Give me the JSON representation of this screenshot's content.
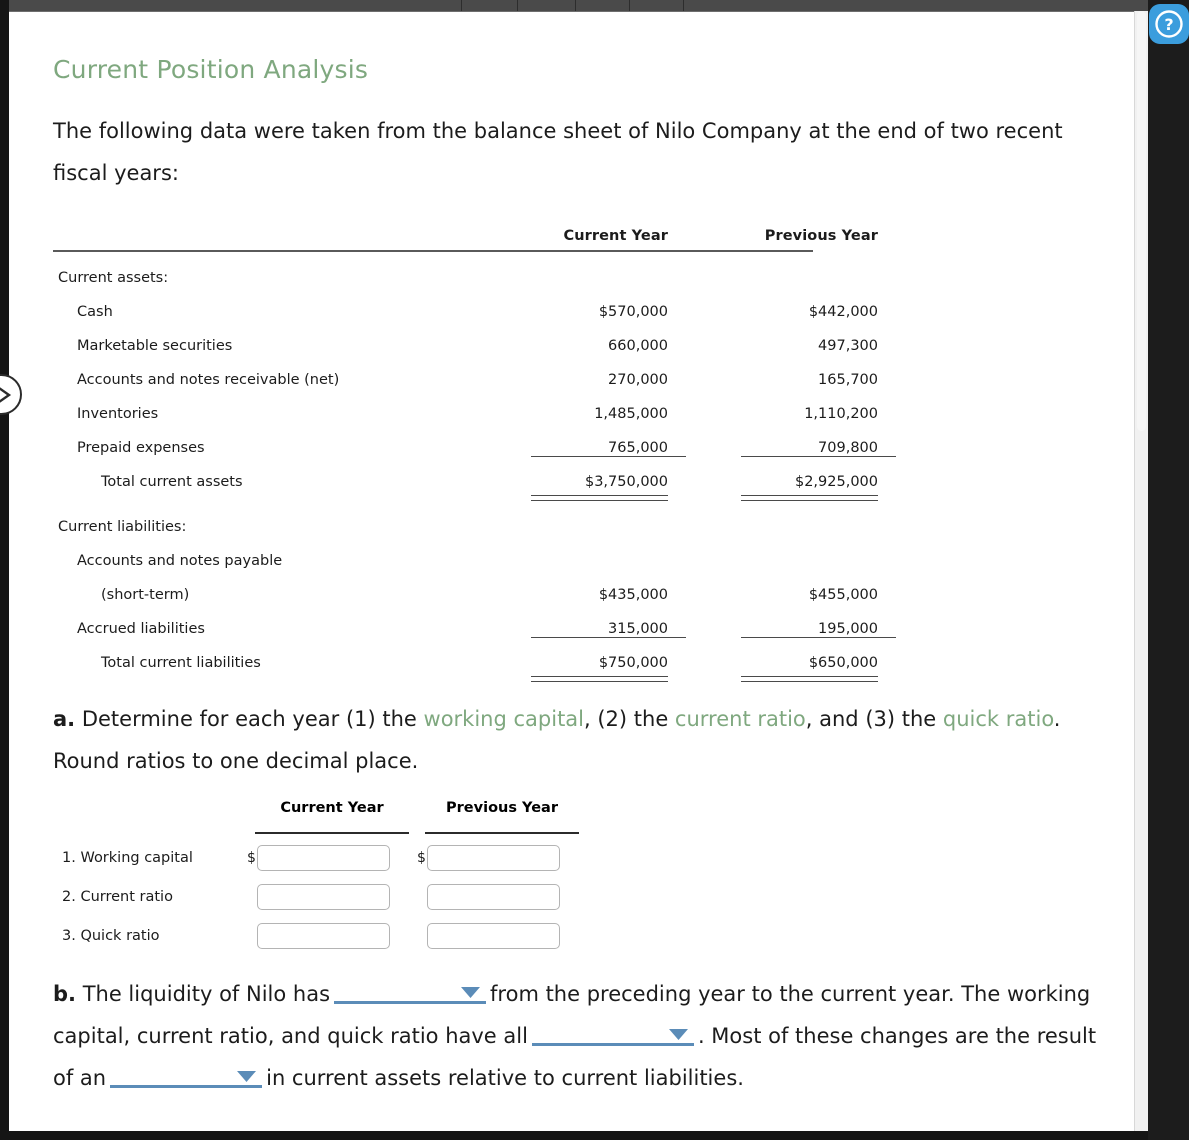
{
  "window": {
    "help_icon": "help-circle-icon",
    "prev_nav_icon": "chevron-right-circle-icon"
  },
  "page": {
    "title": "Current Position Analysis",
    "intro": "The following data were taken from the balance sheet of Nilo Company at the end of two recent fiscal years:",
    "accent_green": "#7fa87f",
    "accent_blue": "#5b8cb8"
  },
  "balance_sheet": {
    "columns": [
      "Current Year",
      "Previous Year"
    ],
    "sections": [
      {
        "heading": "Current assets:",
        "rows": [
          {
            "label": "Cash",
            "indent": 1,
            "current": "$570,000",
            "previous": "$442,000"
          },
          {
            "label": "Marketable securities",
            "indent": 1,
            "current": "660,000",
            "previous": "497,300"
          },
          {
            "label": "Accounts and notes receivable (net)",
            "indent": 1,
            "current": "270,000",
            "previous": "165,700"
          },
          {
            "label": "Inventories",
            "indent": 1,
            "current": "1,485,000",
            "previous": "1,110,200"
          },
          {
            "label": "Prepaid expenses",
            "indent": 1,
            "current": "765,000",
            "previous": "709,800"
          }
        ],
        "total": {
          "label": "Total current assets",
          "indent": 2,
          "current": "$3,750,000",
          "previous": "$2,925,000"
        }
      },
      {
        "heading": "Current liabilities:",
        "rows": [
          {
            "label": "Accounts and notes payable",
            "indent": 1,
            "current": "",
            "previous": ""
          },
          {
            "label": "(short-term)",
            "indent": 2,
            "current": "$435,000",
            "previous": "$455,000"
          },
          {
            "label": "Accrued liabilities",
            "indent": 1,
            "current": "315,000",
            "previous": "195,000"
          }
        ],
        "total": {
          "label": "Total current liabilities",
          "indent": 2,
          "current": "$750,000",
          "previous": "$650,000"
        }
      }
    ]
  },
  "question_a": {
    "letter": "a.",
    "part1": "Determine for each year (1) the ",
    "term1": "working capital",
    "part2": ", (2) the ",
    "term2": "current ratio",
    "part3": ", and (3) the ",
    "term3": "quick ratio",
    "part4": ". Round ratios to one decimal place."
  },
  "answer_grid": {
    "columns": [
      "Current Year",
      "Previous Year"
    ],
    "currency_symbol": "$",
    "rows": [
      {
        "number": "1.",
        "label": "Working capital",
        "has_currency": true,
        "current_value": "",
        "previous_value": ""
      },
      {
        "number": "2.",
        "label": "Current ratio",
        "has_currency": false,
        "current_value": "",
        "previous_value": ""
      },
      {
        "number": "3.",
        "label": "Quick ratio",
        "has_currency": false,
        "current_value": "",
        "previous_value": ""
      }
    ]
  },
  "question_b": {
    "letter": "b.",
    "seg1": "The liquidity of Nilo has",
    "dropdown1_value": "",
    "seg2": "from the preceding year to the current year. The working capital, current ratio, and quick ratio have all",
    "dropdown2_value": "",
    "seg3": ". Most of these changes are the result of an",
    "dropdown3_value": "",
    "seg4": "in current assets relative to current liabilities."
  }
}
